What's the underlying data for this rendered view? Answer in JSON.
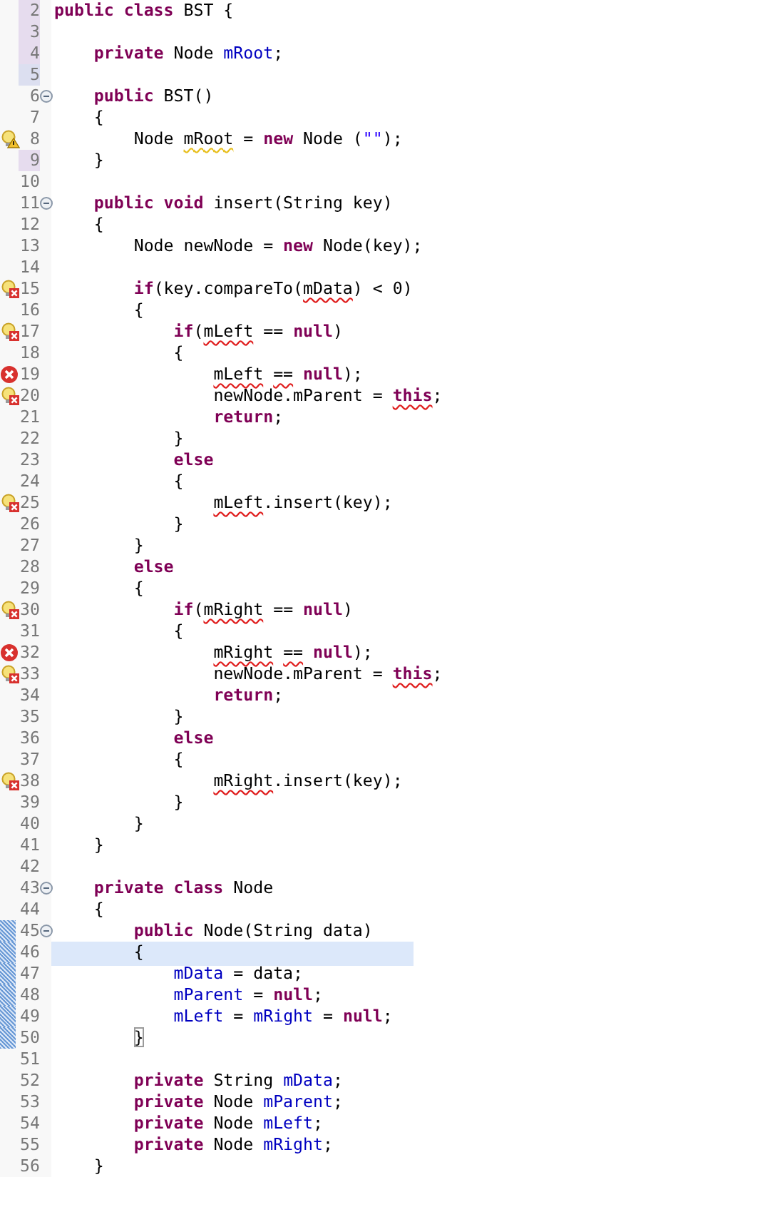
{
  "editor": {
    "lines": [
      {
        "number": "2",
        "band": {
          "kind": "changed"
        },
        "current": false,
        "tokens": [
          {
            "t": "public class ",
            "kind": "keyword"
          },
          {
            "t": "BST {",
            "kind": "plain"
          }
        ]
      },
      {
        "number": "3",
        "band": {
          "kind": "changed"
        },
        "current": false
      },
      {
        "number": "4",
        "band": {
          "kind": "changed"
        },
        "current": false,
        "tokens": [
          {
            "t": "    private ",
            "kind": "keyword"
          },
          {
            "t": "Node ",
            "kind": "plain"
          },
          {
            "t": "mRoot",
            "kind": "field"
          },
          {
            "t": ";",
            "kind": "plain"
          }
        ]
      },
      {
        "number": "5",
        "band": {
          "kind": "removed"
        },
        "current": false
      },
      {
        "number": "6",
        "fold": {
          "expanded": true
        },
        "current": false,
        "tokens": [
          {
            "t": "    public ",
            "kind": "keyword"
          },
          {
            "t": "BST()",
            "kind": "plain"
          }
        ]
      },
      {
        "number": "7",
        "current": false,
        "tokens": [
          {
            "t": "    {",
            "kind": "plain"
          }
        ]
      },
      {
        "number": "8",
        "marker": {
          "kind": "warning"
        },
        "current": false,
        "tokens": [
          {
            "t": "        Node ",
            "kind": "plain"
          },
          {
            "t": "mRoot",
            "kind": "plain",
            "squiggle": {
              "kind": "warning"
            }
          },
          {
            "t": " = ",
            "kind": "plain"
          },
          {
            "t": "new ",
            "kind": "keyword"
          },
          {
            "t": "Node (",
            "kind": "plain"
          },
          {
            "t": "\"\"",
            "kind": "string"
          },
          {
            "t": ");",
            "kind": "plain"
          }
        ]
      },
      {
        "number": "9",
        "band": {
          "kind": "changed"
        },
        "current": false,
        "tokens": [
          {
            "t": "    }",
            "kind": "plain"
          }
        ]
      },
      {
        "number": "10",
        "current": false
      },
      {
        "number": "11",
        "fold": {
          "expanded": true
        },
        "current": false,
        "tokens": [
          {
            "t": "    public void ",
            "kind": "keyword"
          },
          {
            "t": "insert(String key)",
            "kind": "plain"
          }
        ]
      },
      {
        "number": "12",
        "current": false,
        "tokens": [
          {
            "t": "    {",
            "kind": "plain"
          }
        ]
      },
      {
        "number": "13",
        "current": false,
        "tokens": [
          {
            "t": "        Node newNode = ",
            "kind": "plain"
          },
          {
            "t": "new ",
            "kind": "keyword"
          },
          {
            "t": "Node(key);",
            "kind": "plain"
          }
        ]
      },
      {
        "number": "14",
        "current": false
      },
      {
        "number": "15",
        "marker": {
          "kind": "error-fix"
        },
        "current": false,
        "tokens": [
          {
            "t": "        if",
            "kind": "keyword"
          },
          {
            "t": "(key.compareTo(",
            "kind": "plain"
          },
          {
            "t": "mData",
            "kind": "plain",
            "squiggle": {
              "kind": "error"
            }
          },
          {
            "t": ") < 0)",
            "kind": "plain"
          }
        ]
      },
      {
        "number": "16",
        "current": false,
        "tokens": [
          {
            "t": "        {",
            "kind": "plain"
          }
        ]
      },
      {
        "number": "17",
        "marker": {
          "kind": "error-fix"
        },
        "current": false,
        "tokens": [
          {
            "t": "            if",
            "kind": "keyword"
          },
          {
            "t": "(",
            "kind": "plain"
          },
          {
            "t": "mLeft",
            "kind": "plain",
            "squiggle": {
              "kind": "error"
            }
          },
          {
            "t": " == ",
            "kind": "plain"
          },
          {
            "t": "null",
            "kind": "keyword"
          },
          {
            "t": ")",
            "kind": "plain"
          }
        ]
      },
      {
        "number": "18",
        "current": false,
        "tokens": [
          {
            "t": "            {",
            "kind": "plain"
          }
        ]
      },
      {
        "number": "19",
        "marker": {
          "kind": "error"
        },
        "current": false,
        "tokens": [
          {
            "t": "                mLeft",
            "kind": "plain",
            "squiggle": {
              "kind": "error"
            }
          },
          {
            "t": " ==",
            "kind": "plain",
            "squiggle": {
              "kind": "error"
            }
          },
          {
            "t": " null",
            "kind": "keyword"
          },
          {
            "t": ");",
            "kind": "plain"
          }
        ]
      },
      {
        "number": "20",
        "marker": {
          "kind": "error-fix"
        },
        "current": false,
        "tokens": [
          {
            "t": "                newNode.mParent = ",
            "kind": "plain"
          },
          {
            "t": "this",
            "kind": "keyword",
            "squiggle": {
              "kind": "error"
            }
          },
          {
            "t": ";",
            "kind": "plain"
          }
        ]
      },
      {
        "number": "21",
        "current": false,
        "tokens": [
          {
            "t": "                return",
            "kind": "keyword"
          },
          {
            "t": ";",
            "kind": "plain"
          }
        ]
      },
      {
        "number": "22",
        "current": false,
        "tokens": [
          {
            "t": "            }",
            "kind": "plain"
          }
        ]
      },
      {
        "number": "23",
        "current": false,
        "tokens": [
          {
            "t": "            else",
            "kind": "keyword"
          }
        ]
      },
      {
        "number": "24",
        "current": false,
        "tokens": [
          {
            "t": "            {",
            "kind": "plain"
          }
        ]
      },
      {
        "number": "25",
        "marker": {
          "kind": "error-fix"
        },
        "current": false,
        "tokens": [
          {
            "t": "                mLeft",
            "kind": "plain",
            "squiggle": {
              "kind": "error"
            }
          },
          {
            "t": ".insert(key);",
            "kind": "plain"
          }
        ]
      },
      {
        "number": "26",
        "current": false,
        "tokens": [
          {
            "t": "            }",
            "kind": "plain"
          }
        ]
      },
      {
        "number": "27",
        "current": false,
        "tokens": [
          {
            "t": "        }",
            "kind": "plain"
          }
        ]
      },
      {
        "number": "28",
        "current": false,
        "tokens": [
          {
            "t": "        else",
            "kind": "keyword"
          }
        ]
      },
      {
        "number": "29",
        "current": false,
        "tokens": [
          {
            "t": "        {",
            "kind": "plain"
          }
        ]
      },
      {
        "number": "30",
        "marker": {
          "kind": "error-fix"
        },
        "current": false,
        "tokens": [
          {
            "t": "            if",
            "kind": "keyword"
          },
          {
            "t": "(",
            "kind": "plain"
          },
          {
            "t": "mRight",
            "kind": "plain",
            "squiggle": {
              "kind": "error"
            }
          },
          {
            "t": " == ",
            "kind": "plain"
          },
          {
            "t": "null",
            "kind": "keyword"
          },
          {
            "t": ")",
            "kind": "plain"
          }
        ]
      },
      {
        "number": "31",
        "current": false,
        "tokens": [
          {
            "t": "            {",
            "kind": "plain"
          }
        ]
      },
      {
        "number": "32",
        "marker": {
          "kind": "error"
        },
        "current": false,
        "tokens": [
          {
            "t": "                mRight",
            "kind": "plain",
            "squiggle": {
              "kind": "error"
            }
          },
          {
            "t": " ==",
            "kind": "plain",
            "squiggle": {
              "kind": "error"
            }
          },
          {
            "t": " null",
            "kind": "keyword"
          },
          {
            "t": ");",
            "kind": "plain"
          }
        ]
      },
      {
        "number": "33",
        "marker": {
          "kind": "error-fix"
        },
        "current": false,
        "tokens": [
          {
            "t": "                newNode.mParent = ",
            "kind": "plain"
          },
          {
            "t": "this",
            "kind": "keyword",
            "squiggle": {
              "kind": "error"
            }
          },
          {
            "t": ";",
            "kind": "plain"
          }
        ]
      },
      {
        "number": "34",
        "current": false,
        "tokens": [
          {
            "t": "                return",
            "kind": "keyword"
          },
          {
            "t": ";",
            "kind": "plain"
          }
        ]
      },
      {
        "number": "35",
        "current": false,
        "tokens": [
          {
            "t": "            }",
            "kind": "plain"
          }
        ]
      },
      {
        "number": "36",
        "current": false,
        "tokens": [
          {
            "t": "            else",
            "kind": "keyword"
          }
        ]
      },
      {
        "number": "37",
        "current": false,
        "tokens": [
          {
            "t": "            {",
            "kind": "plain"
          }
        ]
      },
      {
        "number": "38",
        "marker": {
          "kind": "error-fix"
        },
        "current": false,
        "tokens": [
          {
            "t": "                mRight",
            "kind": "plain",
            "squiggle": {
              "kind": "error"
            }
          },
          {
            "t": ".insert(key);",
            "kind": "plain"
          }
        ]
      },
      {
        "number": "39",
        "current": false,
        "tokens": [
          {
            "t": "            }",
            "kind": "plain"
          }
        ]
      },
      {
        "number": "40",
        "current": false,
        "tokens": [
          {
            "t": "        }",
            "kind": "plain"
          }
        ]
      },
      {
        "number": "41",
        "current": false,
        "tokens": [
          {
            "t": "    }",
            "kind": "plain"
          }
        ]
      },
      {
        "number": "42",
        "current": false
      },
      {
        "number": "43",
        "fold": {
          "expanded": true
        },
        "current": false,
        "tokens": [
          {
            "t": "    private class ",
            "kind": "keyword"
          },
          {
            "t": "Node",
            "kind": "plain"
          }
        ]
      },
      {
        "number": "44",
        "current": false,
        "tokens": [
          {
            "t": "    {",
            "kind": "plain"
          }
        ]
      },
      {
        "number": "45",
        "fold": {
          "expanded": true
        },
        "band": {
          "kind": "range"
        },
        "current": false,
        "tokens": [
          {
            "t": "        public ",
            "kind": "keyword"
          },
          {
            "t": "Node(String data)",
            "kind": "plain"
          }
        ]
      },
      {
        "number": "46",
        "band": {
          "kind": "range"
        },
        "current": true,
        "tokens": [
          {
            "t": "        {",
            "kind": "plain"
          }
        ]
      },
      {
        "number": "47",
        "band": {
          "kind": "range"
        },
        "current": false,
        "tokens": [
          {
            "t": "            mData",
            "kind": "field"
          },
          {
            "t": " = data;",
            "kind": "plain"
          }
        ]
      },
      {
        "number": "48",
        "band": {
          "kind": "range"
        },
        "current": false,
        "tokens": [
          {
            "t": "            mParent",
            "kind": "field"
          },
          {
            "t": " = ",
            "kind": "plain"
          },
          {
            "t": "null",
            "kind": "keyword"
          },
          {
            "t": ";",
            "kind": "plain"
          }
        ]
      },
      {
        "number": "49",
        "band": {
          "kind": "range"
        },
        "current": false,
        "tokens": [
          {
            "t": "            mLeft",
            "kind": "field"
          },
          {
            "t": " = ",
            "kind": "plain"
          },
          {
            "t": "mRight",
            "kind": "field"
          },
          {
            "t": " = ",
            "kind": "plain"
          },
          {
            "t": "null",
            "kind": "keyword"
          },
          {
            "t": ";",
            "kind": "plain"
          }
        ]
      },
      {
        "number": "50",
        "band": {
          "kind": "range"
        },
        "current": false,
        "tokens": [
          {
            "t": "        }",
            "kind": "plain",
            "bracket_match": true
          }
        ]
      },
      {
        "number": "51",
        "current": false
      },
      {
        "number": "52",
        "current": false,
        "tokens": [
          {
            "t": "        private ",
            "kind": "keyword"
          },
          {
            "t": "String ",
            "kind": "plain"
          },
          {
            "t": "mData",
            "kind": "field"
          },
          {
            "t": ";",
            "kind": "plain"
          }
        ]
      },
      {
        "number": "53",
        "current": false,
        "tokens": [
          {
            "t": "        private ",
            "kind": "keyword"
          },
          {
            "t": "Node ",
            "kind": "plain"
          },
          {
            "t": "mParent",
            "kind": "field"
          },
          {
            "t": ";",
            "kind": "plain"
          }
        ]
      },
      {
        "number": "54",
        "current": false,
        "tokens": [
          {
            "t": "        private ",
            "kind": "keyword"
          },
          {
            "t": "Node ",
            "kind": "plain"
          },
          {
            "t": "mLeft",
            "kind": "field"
          },
          {
            "t": ";",
            "kind": "plain"
          }
        ]
      },
      {
        "number": "55",
        "current": false,
        "tokens": [
          {
            "t": "        private ",
            "kind": "keyword"
          },
          {
            "t": "Node ",
            "kind": "plain"
          },
          {
            "t": "mRight",
            "kind": "field"
          },
          {
            "t": ";",
            "kind": "plain"
          }
        ]
      },
      {
        "number": "56",
        "current": false,
        "tokens": [
          {
            "t": "    }",
            "kind": "plain"
          }
        ]
      }
    ]
  }
}
